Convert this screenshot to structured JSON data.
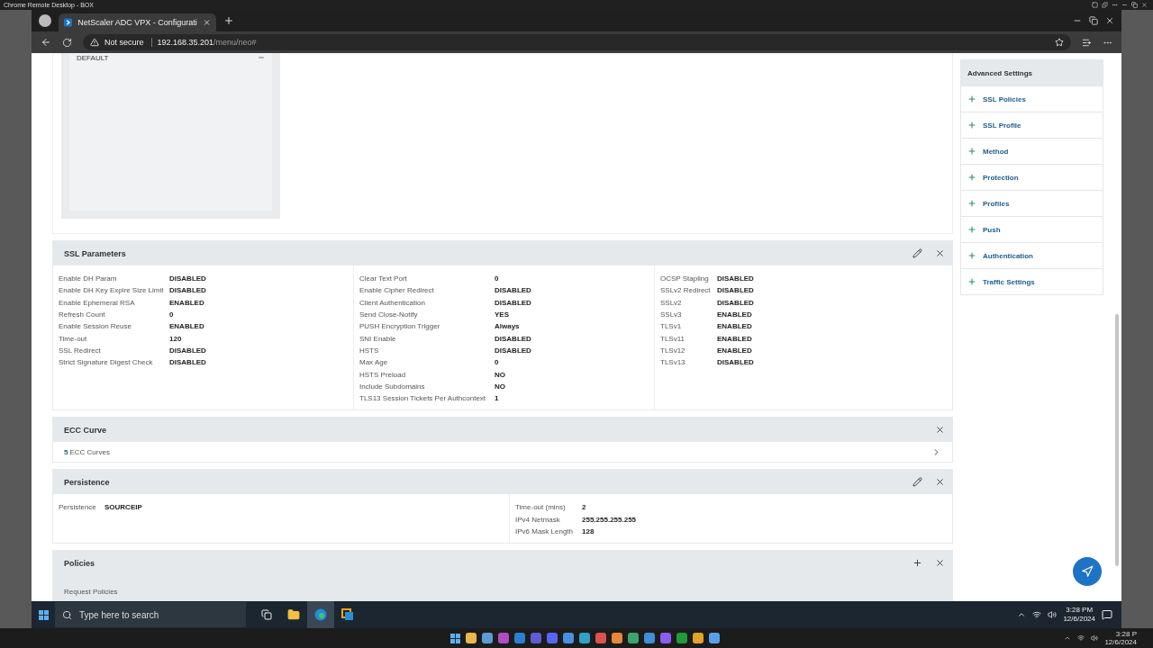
{
  "remote_window": {
    "title": "Chrome Remote Desktop - BOX"
  },
  "browser": {
    "tab_title": "NetScaler ADC VPX - Configurati",
    "security": "Not secure",
    "url_host": "192.168.35.201",
    "url_path": "/menu/neo#"
  },
  "top_panel": {
    "items": [
      {
        "label": "DEFAULT"
      }
    ]
  },
  "ssl_parameters": {
    "title": "SSL Parameters",
    "columns": [
      [
        {
          "label": "Enable DH Param",
          "value": "DISABLED"
        },
        {
          "label": "Enable DH Key Expire Size Limit",
          "value": "DISABLED"
        },
        {
          "label": "Enable Ephemeral RSA",
          "value": "ENABLED"
        },
        {
          "label": "Refresh Count",
          "value": "0"
        },
        {
          "label": "Enable Session Reuse",
          "value": "ENABLED"
        },
        {
          "label": "Time-out",
          "value": "120"
        },
        {
          "label": "SSL Redirect",
          "value": "DISABLED"
        },
        {
          "label": "Strict Signature Digest Check",
          "value": "DISABLED"
        }
      ],
      [
        {
          "label": "Clear Text Port",
          "value": "0"
        },
        {
          "label": "Enable Cipher Redirect",
          "value": "DISABLED"
        },
        {
          "label": "Client Authentication",
          "value": "DISABLED"
        },
        {
          "label": "Send Close-Notify",
          "value": "YES"
        },
        {
          "label": "PUSH Encryption Trigger",
          "value": "Always"
        },
        {
          "label": "SNI Enable",
          "value": "DISABLED"
        },
        {
          "label": "HSTS",
          "value": "DISABLED"
        },
        {
          "label": "Max Age",
          "value": "0"
        },
        {
          "label": "HSTS Preload",
          "value": "NO"
        },
        {
          "label": "Include Subdomains",
          "value": "NO"
        },
        {
          "label": "TLS13 Session Tickets Per Authcontext",
          "value": "1"
        }
      ],
      [
        {
          "label": "OCSP Stapling",
          "value": "DISABLED"
        },
        {
          "label": "SSLv2 Redirect",
          "value": "DISABLED"
        },
        {
          "label": "SSLv2",
          "value": "DISABLED"
        },
        {
          "label": "SSLv3",
          "value": "ENABLED"
        },
        {
          "label": "TLSv1",
          "value": "ENABLED"
        },
        {
          "label": "TLSv11",
          "value": "ENABLED"
        },
        {
          "label": "TLSv12",
          "value": "ENABLED"
        },
        {
          "label": "TLSv13",
          "value": "DISABLED"
        }
      ]
    ]
  },
  "ecc_curve": {
    "title": "ECC Curve",
    "count": "5",
    "label": "ECC Curves"
  },
  "persistence": {
    "title": "Persistence",
    "columns": [
      [
        {
          "label": "Persistence",
          "value": "SOURCEIP"
        }
      ],
      [
        {
          "label": "Time-out (mins)",
          "value": "2"
        },
        {
          "label": "IPv4 Netmask",
          "value": "255.255.255.255"
        },
        {
          "label": "IPv6 Mask Length",
          "value": "128"
        }
      ]
    ]
  },
  "policies": {
    "title": "Policies",
    "subtitle": "Request Policies"
  },
  "advanced_settings": {
    "title": "Advanced Settings",
    "items": [
      {
        "label": "SSL Policies"
      },
      {
        "label": "SSL Profile"
      },
      {
        "label": "Method"
      },
      {
        "label": "Protection"
      },
      {
        "label": "Profiles"
      },
      {
        "label": "Push"
      },
      {
        "label": "Authentication"
      },
      {
        "label": "Traffic Settings"
      }
    ]
  },
  "taskbar": {
    "search_placeholder": "Type here to search",
    "time": "3:28 PM",
    "date": "12/6/2024"
  },
  "host_taskbar": {
    "time": "3:28 P",
    "date": "12/6/2024"
  }
}
